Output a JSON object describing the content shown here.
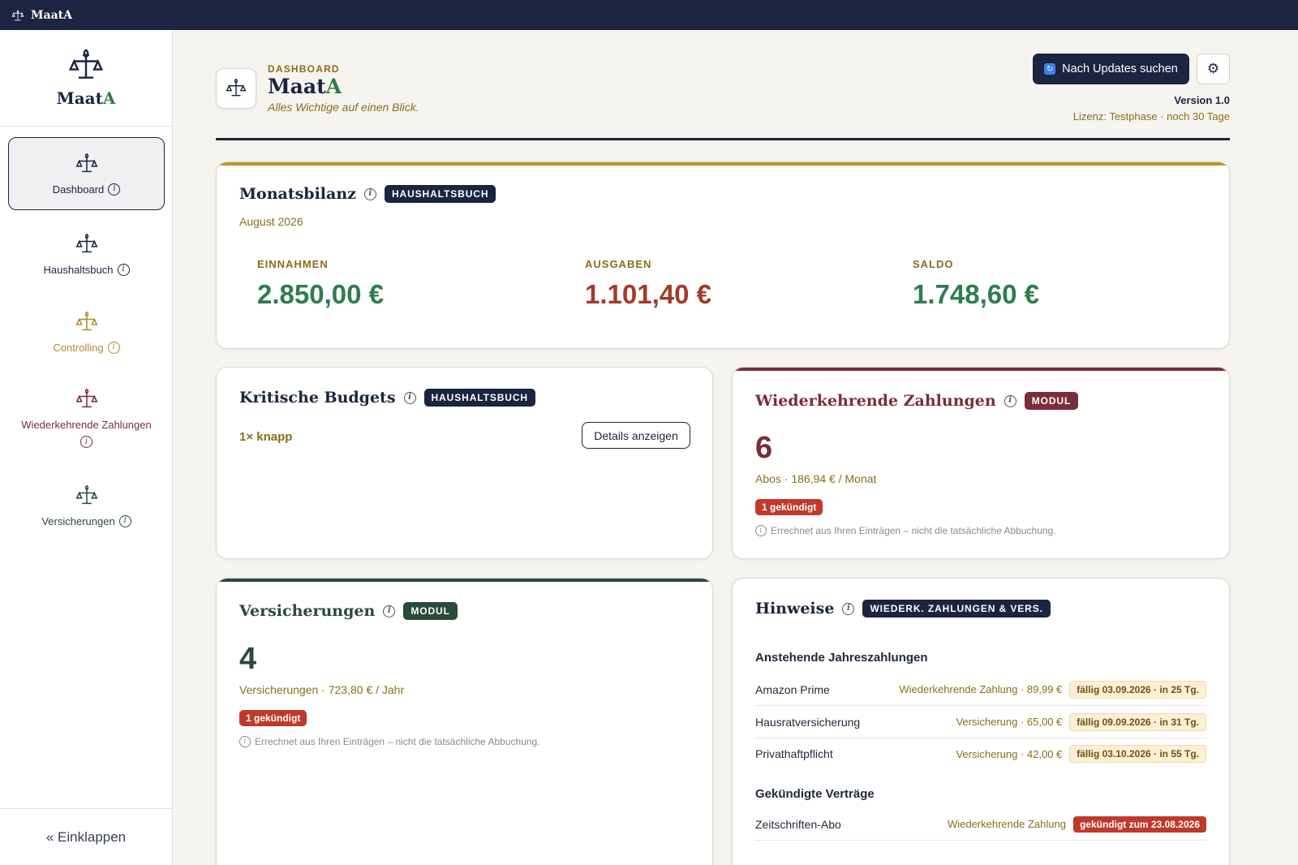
{
  "app": {
    "title": "MaatA",
    "title_main": "Maat",
    "title_accent": "A"
  },
  "sidebar": {
    "items": [
      {
        "label": "Dashboard"
      },
      {
        "label": "Haushaltsbuch"
      },
      {
        "label": "Controlling"
      },
      {
        "label": "Wiederkehrende Zahlungen"
      },
      {
        "label": "Versicherungen"
      }
    ],
    "collapse_label": "« Einklappen"
  },
  "header": {
    "kicker": "DASHBOARD",
    "title_main": "Maat",
    "title_accent": "A",
    "subtitle": "Alles Wichtige auf einen Blick.",
    "update_button": "Nach Updates suchen",
    "version": "Version 1.0",
    "license": "Lizenz: Testphase · noch 30 Tage"
  },
  "colors": {
    "navy": "#1b2440",
    "gold": "#8a6d1d",
    "green": "#2e7d4f",
    "red": "#a23b2a",
    "maroon": "#7a2d3a",
    "darkgreen": "#2a4a3a"
  },
  "monatsbilanz": {
    "title": "Monatsbilanz",
    "badge": "HAUSHALTSBUCH",
    "period": "August 2026",
    "kpis": [
      {
        "label": "EINNAHMEN",
        "value": "2.850,00 €"
      },
      {
        "label": "AUSGABEN",
        "value": "1.101,40 €"
      },
      {
        "label": "SALDO",
        "value": "1.748,60 €"
      }
    ]
  },
  "budgets": {
    "title": "Kritische Budgets",
    "badge": "HAUSHALTSBUCH",
    "status": "1× knapp",
    "details_button": "Details anzeigen"
  },
  "wiederkehrend": {
    "title": "Wiederkehrende Zahlungen",
    "badge": "MODUL",
    "count": "6",
    "summary": "Abos · 186,94 € / Monat",
    "cancelled": "1 gekündigt",
    "note": "Errechnet aus Ihren Einträgen – nicht die tatsächliche Abbuchung."
  },
  "versicherungen": {
    "title": "Versicherungen",
    "badge": "MODUL",
    "count": "4",
    "summary": "Versicherungen · 723,80 € / Jahr",
    "cancelled": "1 gekündigt",
    "note": "Errechnet aus Ihren Einträgen – nicht die tatsächliche Abbuchung."
  },
  "hinweise": {
    "title": "Hinweise",
    "badge": "WIEDERK. ZAHLUNGEN & VERS.",
    "section_upcoming": "Anstehende Jahreszahlungen",
    "upcoming": [
      {
        "name": "Amazon Prime",
        "meta": "Wiederkehrende Zahlung · 89,99 €",
        "due": "fällig 03.09.2026 · in 25 Tg."
      },
      {
        "name": "Hausratversicherung",
        "meta": "Versicherung · 65,00 €",
        "due": "fällig 09.09.2026 · in 31 Tg."
      },
      {
        "name": "Privathaftpflicht",
        "meta": "Versicherung · 42,00 €",
        "due": "fällig 03.10.2026 · in 55 Tg."
      }
    ],
    "section_cancelled": "Gekündigte Verträge",
    "cancelled": [
      {
        "name": "Zeitschriften-Abo",
        "meta": "Wiederkehrende Zahlung",
        "due": "gekündigt zum 23.08.2026"
      }
    ]
  }
}
